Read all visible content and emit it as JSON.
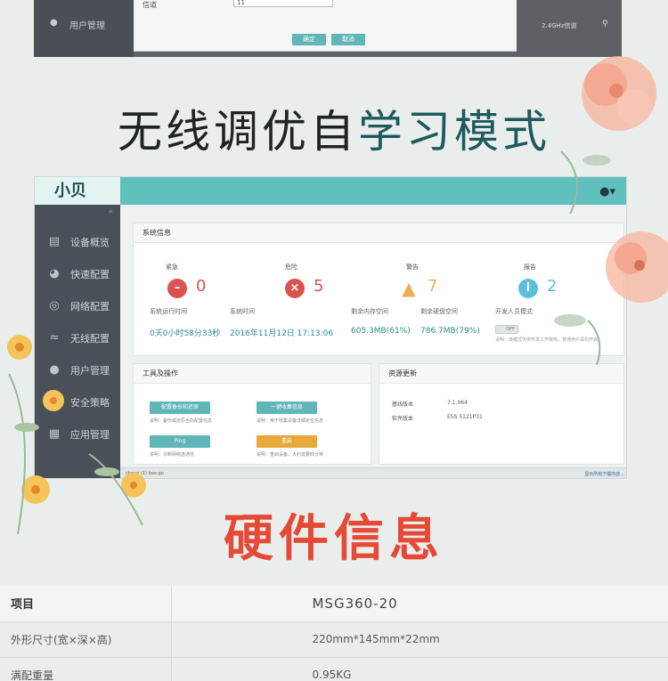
{
  "top_screenshot": {
    "sidebar_item": "用户管理",
    "field_label": "信道",
    "field_value": "11",
    "confirm_label": "确定",
    "cancel_label": "取消",
    "right_text": "2.4GHz信道",
    "search_icon": "search-icon"
  },
  "headings": {
    "mode_title_part1": "无线调优自",
    "mode_title_part2": "学习模式",
    "hardware_title": "硬件信息"
  },
  "app": {
    "logo": "小贝",
    "user_icon": "user-icon",
    "sidebar": [
      {
        "label": "设备概览",
        "icon": "chart-icon"
      },
      {
        "label": "快速配置",
        "icon": "gauge-icon"
      },
      {
        "label": "网络配置",
        "icon": "globe-icon"
      },
      {
        "label": "无线配置",
        "icon": "wifi-icon"
      },
      {
        "label": "用户管理",
        "icon": "user-icon"
      },
      {
        "label": "安全策略",
        "icon": "shield-icon"
      },
      {
        "label": "应用管理",
        "icon": "grid-icon"
      }
    ],
    "system_info": {
      "title": "系统信息",
      "alerts": [
        {
          "label": "紧急",
          "value": "0",
          "color": "#d9534f",
          "icon": "minus-icon"
        },
        {
          "label": "危险",
          "value": "5",
          "color": "#d9534f",
          "icon": "close-icon"
        },
        {
          "label": "警告",
          "value": "7",
          "color": "#f0ad4e",
          "icon": "warning-icon"
        },
        {
          "label": "报告",
          "value": "2",
          "color": "#5bc0de",
          "icon": "info-icon"
        }
      ],
      "stats": [
        {
          "label": "系统运行时间",
          "value": "0天0小时58分33秒"
        },
        {
          "label": "系统时间",
          "value": "2016年11月12日 17:13:06"
        },
        {
          "label": "剩余内存空间",
          "value": "605.3MB(61%)"
        },
        {
          "label": "剩余硬盘空间",
          "value": "786.7MB(79%)"
        }
      ],
      "dev_mode_label": "开发人员模式",
      "dev_mode_toggle": "OFF",
      "dev_mode_note": "说明：该模式仅供开发工作使用，普通用户请勿开启"
    },
    "tools": {
      "title": "工具及操作",
      "buttons": [
        {
          "label": "配置备份和还原",
          "note": "说明：备份或还原当前配置信息",
          "color": "#5fb5b7"
        },
        {
          "label": "一键收集信息",
          "note": "说明：用于收集设备详细定位信息",
          "color": "#5fb5b7"
        },
        {
          "label": "Ping",
          "note": "说明：诊断网络连通性",
          "color": "#5fb5b7"
        },
        {
          "label": "重启",
          "note": "说明：重启设备，大约需要四分钟",
          "color": "#e6a93a"
        }
      ]
    },
    "updates": {
      "title": "资源更新",
      "rows": [
        {
          "key": "基线版本",
          "value": "7.1.064"
        },
        {
          "key": "软件版本",
          "value": "ESS 5121P31"
        }
      ]
    },
    "statusbar": {
      "left": "cheng (1) bee.go",
      "right": "显示所有下载内容..."
    }
  },
  "spec_table": {
    "rows": [
      {
        "key": "项目",
        "value": "MSG360-20"
      },
      {
        "key": "外形尺寸(宽×深×高)",
        "value": "220mm*145mm*22mm"
      },
      {
        "key": "满配重量",
        "value": "0.95KG"
      }
    ]
  }
}
